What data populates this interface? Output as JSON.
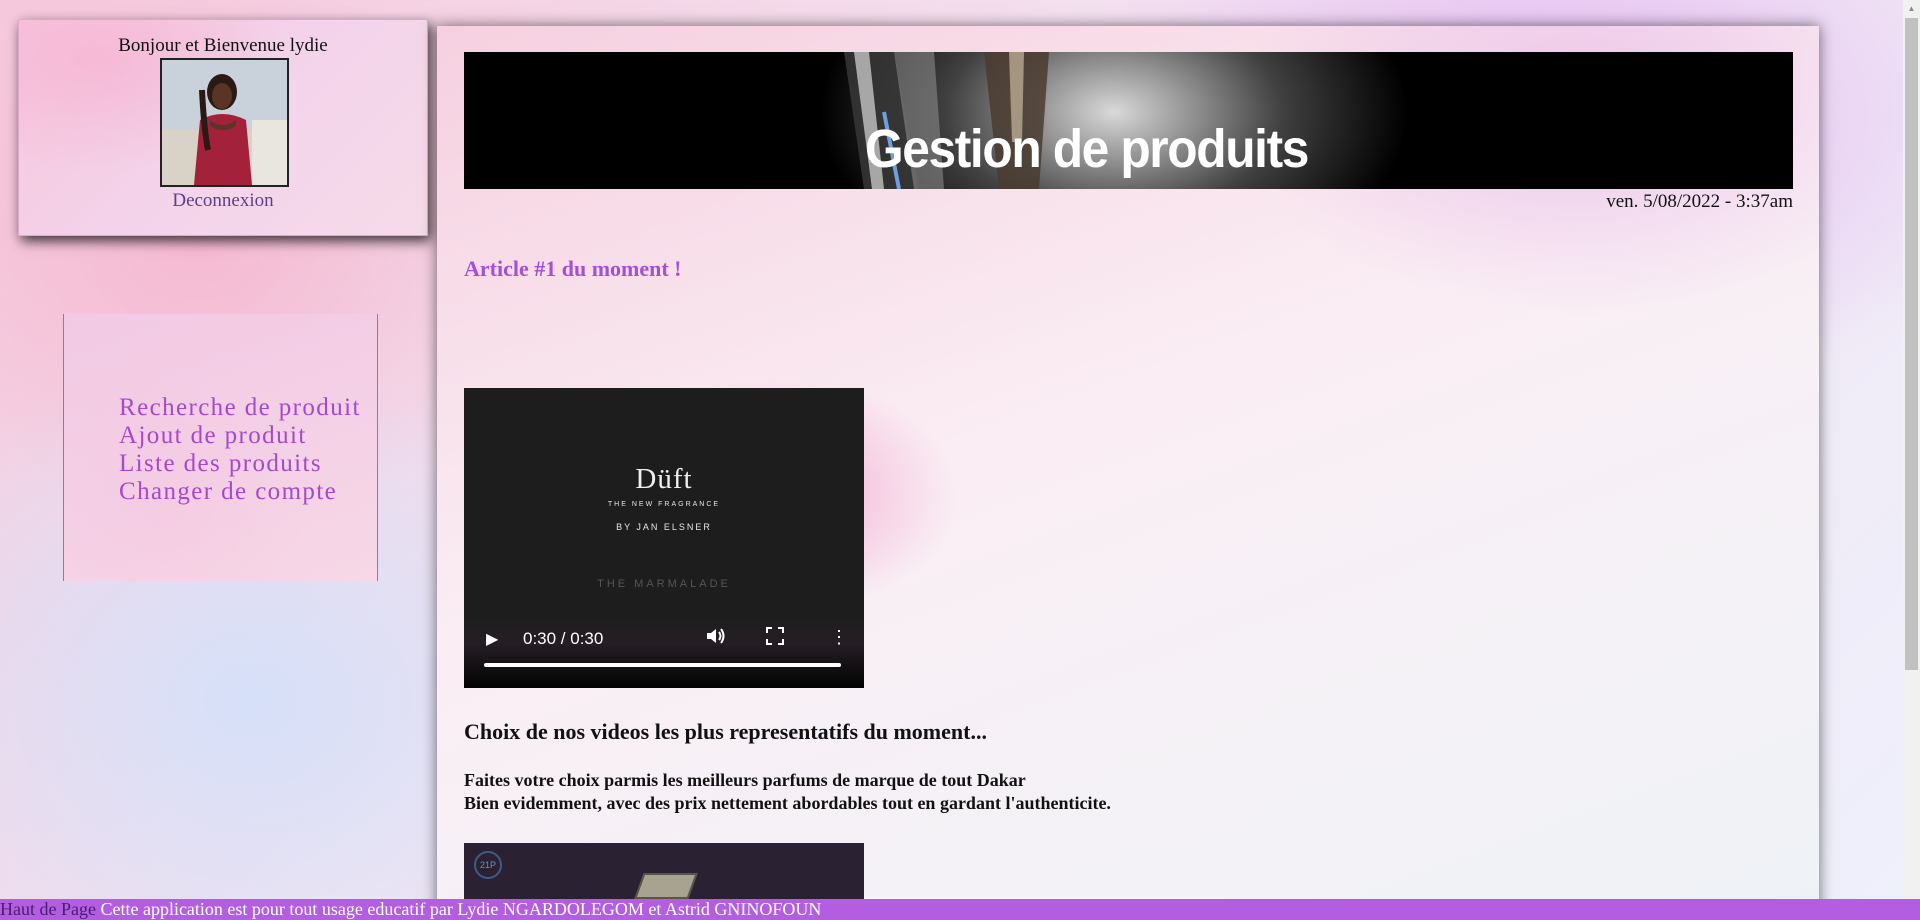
{
  "user_panel": {
    "greeting": "Bonjour et Bienvenue lydie",
    "logout_label": "Deconnexion"
  },
  "menu": {
    "items": [
      {
        "label": "Recherche de produit"
      },
      {
        "label": "Ajout de produit"
      },
      {
        "label": "Liste des produits"
      },
      {
        "label": "Changer de compte"
      }
    ]
  },
  "header": {
    "title": "Gestion de produits",
    "date": "ven. 5/08/2022 - 3:37am"
  },
  "main": {
    "article_title": "Article #1 du moment !",
    "video1": {
      "brand": "Düft",
      "subtitle": "THE NEW FRAGRANCE",
      "author": "BY JAN ELSNER",
      "studio": "THE MARMALADE",
      "time": "0:30 / 0:30",
      "progress": 1.0
    },
    "section_heading": "Choix de nos videos les plus representatifs du moment...",
    "desc_line1": "Faites votre choix parmis les meilleurs parfums de marque de tout Dakar",
    "desc_line2": "Bien evidemment, avec des prix nettement abordables tout en gardant l'authenticite.",
    "video2": {
      "badge": "21P"
    }
  },
  "footer": {
    "top_link": "Haut de Page",
    "text": " Cette application est pour tout usage educatif par Lydie NGARDOLEGOM et Astrid GNINOFOUN"
  },
  "colors": {
    "accent": "#a449cf",
    "footer_bg": "#b35de1",
    "banner_bg": "#000000"
  },
  "icons": [
    "play-icon",
    "volume-icon",
    "fullscreen-icon",
    "more-options-icon",
    "scroll-up-arrow-icon"
  ]
}
